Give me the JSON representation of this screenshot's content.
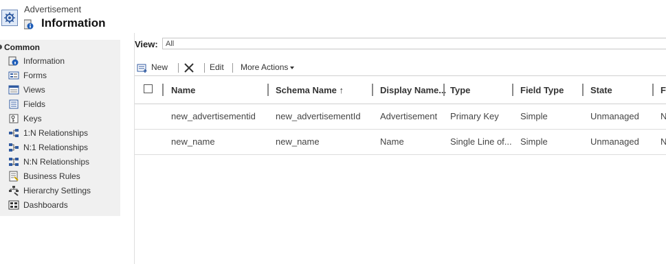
{
  "header": {
    "breadcrumb": "Advertisement",
    "title": "Information"
  },
  "sidebar": {
    "group_label": "Common",
    "items": [
      {
        "label": "Information",
        "icon": "info-icon"
      },
      {
        "label": "Forms",
        "icon": "form-icon"
      },
      {
        "label": "Views",
        "icon": "view-icon"
      },
      {
        "label": "Fields",
        "icon": "fields-icon"
      },
      {
        "label": "Keys",
        "icon": "key-icon"
      },
      {
        "label": "1:N Relationships",
        "icon": "relationship-1n-icon"
      },
      {
        "label": "N:1 Relationships",
        "icon": "relationship-n1-icon"
      },
      {
        "label": "N:N Relationships",
        "icon": "relationship-nn-icon"
      },
      {
        "label": "Business Rules",
        "icon": "business-rules-icon"
      },
      {
        "label": "Hierarchy Settings",
        "icon": "hierarchy-icon"
      },
      {
        "label": "Dashboards",
        "icon": "dashboard-icon"
      }
    ]
  },
  "view": {
    "label": "View:",
    "value": "All"
  },
  "toolbar": {
    "new_label": "New",
    "edit_label": "Edit",
    "more_label": "More Actions"
  },
  "grid": {
    "columns": [
      "Name",
      "Schema Name ↑",
      "Display Name...",
      "Type",
      "Field Type",
      "State",
      "Fi"
    ],
    "rows": [
      [
        "new_advertisementid",
        "new_advertisementId",
        "Advertisement",
        "Primary Key",
        "Simple",
        "Unmanaged",
        "N"
      ],
      [
        "new_name",
        "new_name",
        "Name",
        "Single Line of...",
        "Simple",
        "Unmanaged",
        "N"
      ]
    ]
  }
}
